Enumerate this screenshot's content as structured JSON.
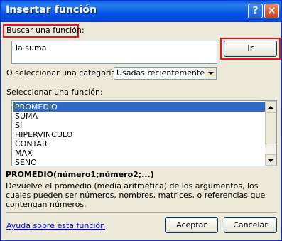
{
  "window": {
    "title": "Insertar función"
  },
  "title_buttons": {
    "help": "?",
    "close": "×"
  },
  "search": {
    "label": "Buscar una función:",
    "value": "la suma",
    "go_button": "Ir"
  },
  "category": {
    "label": "O seleccionar una categoría:",
    "selected": "Usadas recientemente"
  },
  "function_list": {
    "label": "Seleccionar una función:",
    "items": [
      "PROMEDIO",
      "SUMA",
      "SI",
      "HIPERVINCULO",
      "CONTAR",
      "MAX",
      "SENO"
    ],
    "selected_index": 0
  },
  "description": {
    "signature": "PROMEDIO(número1;número2;...)",
    "text": "Devuelve el promedio (media aritmética) de los argumentos, los cuales pueden ser números, nombres, matrices, o referencias que contengan números."
  },
  "footer": {
    "help_link": "Ayuda sobre esta función",
    "accept_button": "Aceptar",
    "cancel_button": "Cancelar"
  },
  "colors": {
    "title_bar": "#0553e4",
    "selection": "#316ac5",
    "highlight_box": "#e8141e",
    "dialog_bg": "#ece9d8"
  }
}
